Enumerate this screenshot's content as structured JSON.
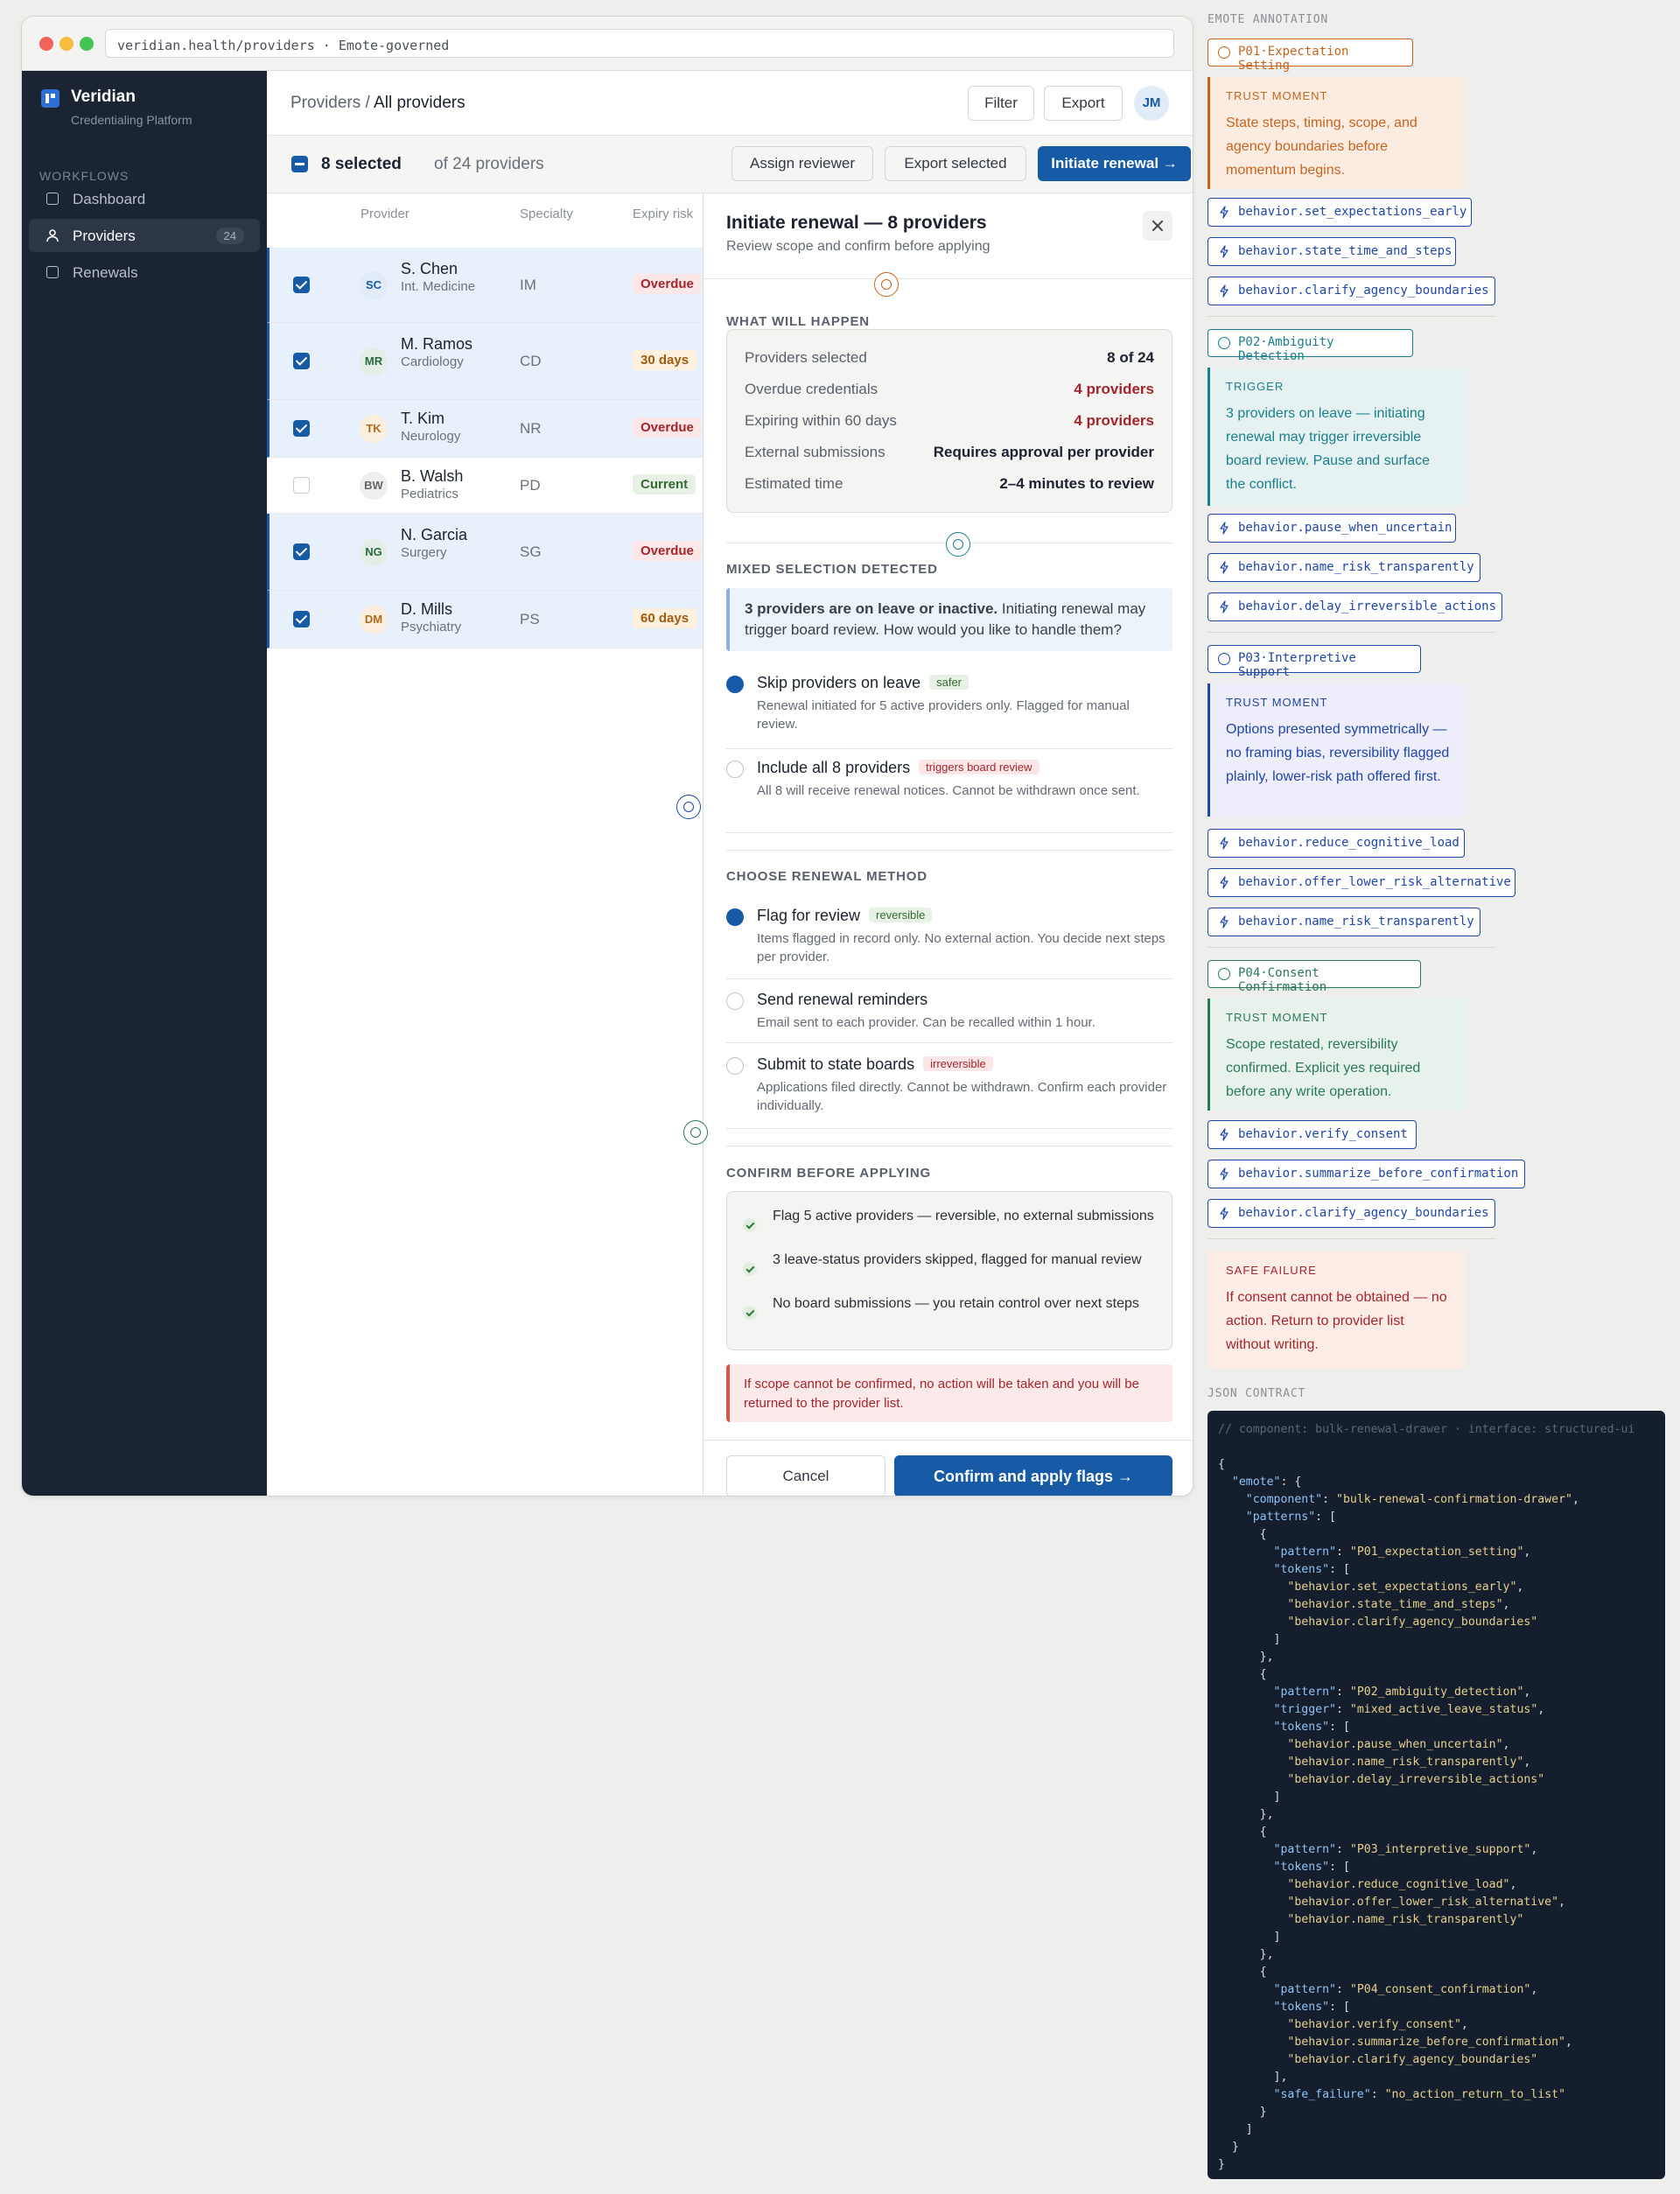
{
  "browser": {
    "url": "veridian.health/providers · Emote-governed"
  },
  "sidebar": {
    "brand": "Veridian",
    "subtitle": "Credentialing Platform",
    "section": "WORKFLOWS",
    "items": [
      {
        "label": "Dashboard",
        "count": ""
      },
      {
        "label": "Providers",
        "count": "24"
      },
      {
        "label": "Renewals",
        "count": ""
      }
    ]
  },
  "header": {
    "breadcrumb_root": "Providers /",
    "breadcrumb_current": "All providers",
    "filter_label": "Filter",
    "export_label": "Export",
    "avatar_initials": "JM"
  },
  "selection": {
    "selected_text": "8 selected",
    "total_text": "of 24 providers",
    "assign_label": "Assign reviewer",
    "export_selected_label": "Export selected",
    "initiate_label": "Initiate renewal →"
  },
  "table": {
    "columns": [
      "Provider",
      "Specialty",
      "Expiry risk"
    ],
    "rows": [
      {
        "initials": "SC",
        "name": "S. Chen",
        "specialty": "Int. Medicine",
        "code": "IM",
        "status": "Overdue",
        "selected": true
      },
      {
        "initials": "MR",
        "name": "M. Ramos",
        "specialty": "Cardiology",
        "code": "CD",
        "status": "30 days",
        "selected": true
      },
      {
        "initials": "TK",
        "name": "T. Kim",
        "specialty": "Neurology",
        "code": "NR",
        "status": "Overdue",
        "selected": true
      },
      {
        "initials": "BW",
        "name": "B. Walsh",
        "specialty": "Pediatrics",
        "code": "PD",
        "status": "Current",
        "selected": false
      },
      {
        "initials": "NG",
        "name": "N. Garcia",
        "specialty": "Surgery",
        "code": "SG",
        "status": "Overdue",
        "selected": true
      },
      {
        "initials": "DM",
        "name": "D. Mills",
        "specialty": "Psychiatry",
        "code": "PS",
        "status": "60 days",
        "selected": true
      }
    ]
  },
  "drawer": {
    "title": "Initiate renewal — 8 providers",
    "subtitle": "Review scope and confirm before applying",
    "what_heading": "WHAT WILL HAPPEN",
    "summary": [
      {
        "label": "Providers selected",
        "value": "8 of 24"
      },
      {
        "label": "Overdue credentials",
        "value": "4 providers"
      },
      {
        "label": "Expiring within 60 days",
        "value": "4 providers"
      },
      {
        "label": "External submissions",
        "value": "Requires approval per provider"
      },
      {
        "label": "Estimated time",
        "value": "2–4 minutes to review"
      }
    ],
    "mixed_heading": "MIXED SELECTION DETECTED",
    "mixed_note_bold": "3 providers are on leave or inactive.",
    "mixed_note_rest": " Initiating renewal may trigger board review. How would you like to handle them?",
    "leave_options": [
      {
        "title": "Skip providers on leave",
        "tag": "safer",
        "desc": "Renewal initiated for 5 active providers only. Flagged for manual review."
      },
      {
        "title": "Include all 8 providers",
        "tag": "triggers board review",
        "desc": "All 8 will receive renewal notices. Cannot be withdrawn once sent."
      }
    ],
    "method_heading": "CHOOSE RENEWAL METHOD",
    "methods": [
      {
        "title": "Flag for review",
        "tag": "reversible",
        "desc": "Items flagged in record only. No external action. You decide next steps per provider."
      },
      {
        "title": "Send renewal reminders",
        "tag": "",
        "desc": "Email sent to each provider. Can be recalled within 1 hour."
      },
      {
        "title": "Submit to state boards",
        "tag": "irreversible",
        "desc": "Applications filed directly. Cannot be withdrawn. Confirm each provider individually."
      }
    ],
    "confirm_heading": "CONFIRM BEFORE APPLYING",
    "confirm_items": [
      "Flag 5 active providers — reversible, no external submissions",
      "3 leave-status providers skipped, flagged for manual review",
      "No board submissions — you retain control over next steps"
    ],
    "safe_failure": "If scope cannot be confirmed, no action will be taken and you will be returned to the provider list.",
    "cancel_label": "Cancel",
    "apply_label": "Confirm and apply flags →"
  },
  "annotation": {
    "heading": "EMOTE ANNOTATION",
    "patterns": [
      {
        "tag": "P01·Expectation Setting",
        "card_key": "TRUST MOMENT",
        "card_text": "State steps, timing, scope, and agency boundaries before momentum begins.",
        "tokens": [
          "behavior.set_expectations_early",
          "behavior.state_time_and_steps",
          "behavior.clarify_agency_boundaries"
        ]
      },
      {
        "tag": "P02·Ambiguity Detection",
        "card_key": "TRIGGER",
        "card_text": "3 providers on leave — initiating renewal may trigger irreversible board review. Pause and surface the conflict.",
        "tokens": [
          "behavior.pause_when_uncertain",
          "behavior.name_risk_transparently",
          "behavior.delay_irreversible_actions"
        ]
      },
      {
        "tag": "P03·Interpretive Support",
        "card_key": "TRUST MOMENT",
        "card_text": "Options presented symmetrically — no framing bias, reversibility flagged plainly, lower-risk path offered first.",
        "tokens": [
          "behavior.reduce_cognitive_load",
          "behavior.offer_lower_risk_alternative",
          "behavior.name_risk_transparently"
        ]
      },
      {
        "tag": "P04·Consent Confirmation",
        "card_key": "TRUST MOMENT",
        "card_text": "Scope restated, reversibility confirmed. Explicit yes required before any write operation.",
        "tokens": [
          "behavior.verify_consent",
          "behavior.summarize_before_confirmation",
          "behavior.clarify_agency_boundaries"
        ]
      }
    ],
    "safe_key": "SAFE FAILURE",
    "safe_text": "If consent cannot be obtained — no action. Return to provider list without writing.",
    "json_heading": "JSON CONTRACT",
    "json_comment": "// component: bulk-renewal-drawer · interface: structured-ui"
  },
  "colors": {
    "primary": "#175aa6",
    "sidebar": "#1b2433",
    "p01": "#c8641e",
    "p02": "#1a7f8c",
    "p03": "#2046a8",
    "p04": "#2b7a57",
    "danger": "#a4262c"
  }
}
